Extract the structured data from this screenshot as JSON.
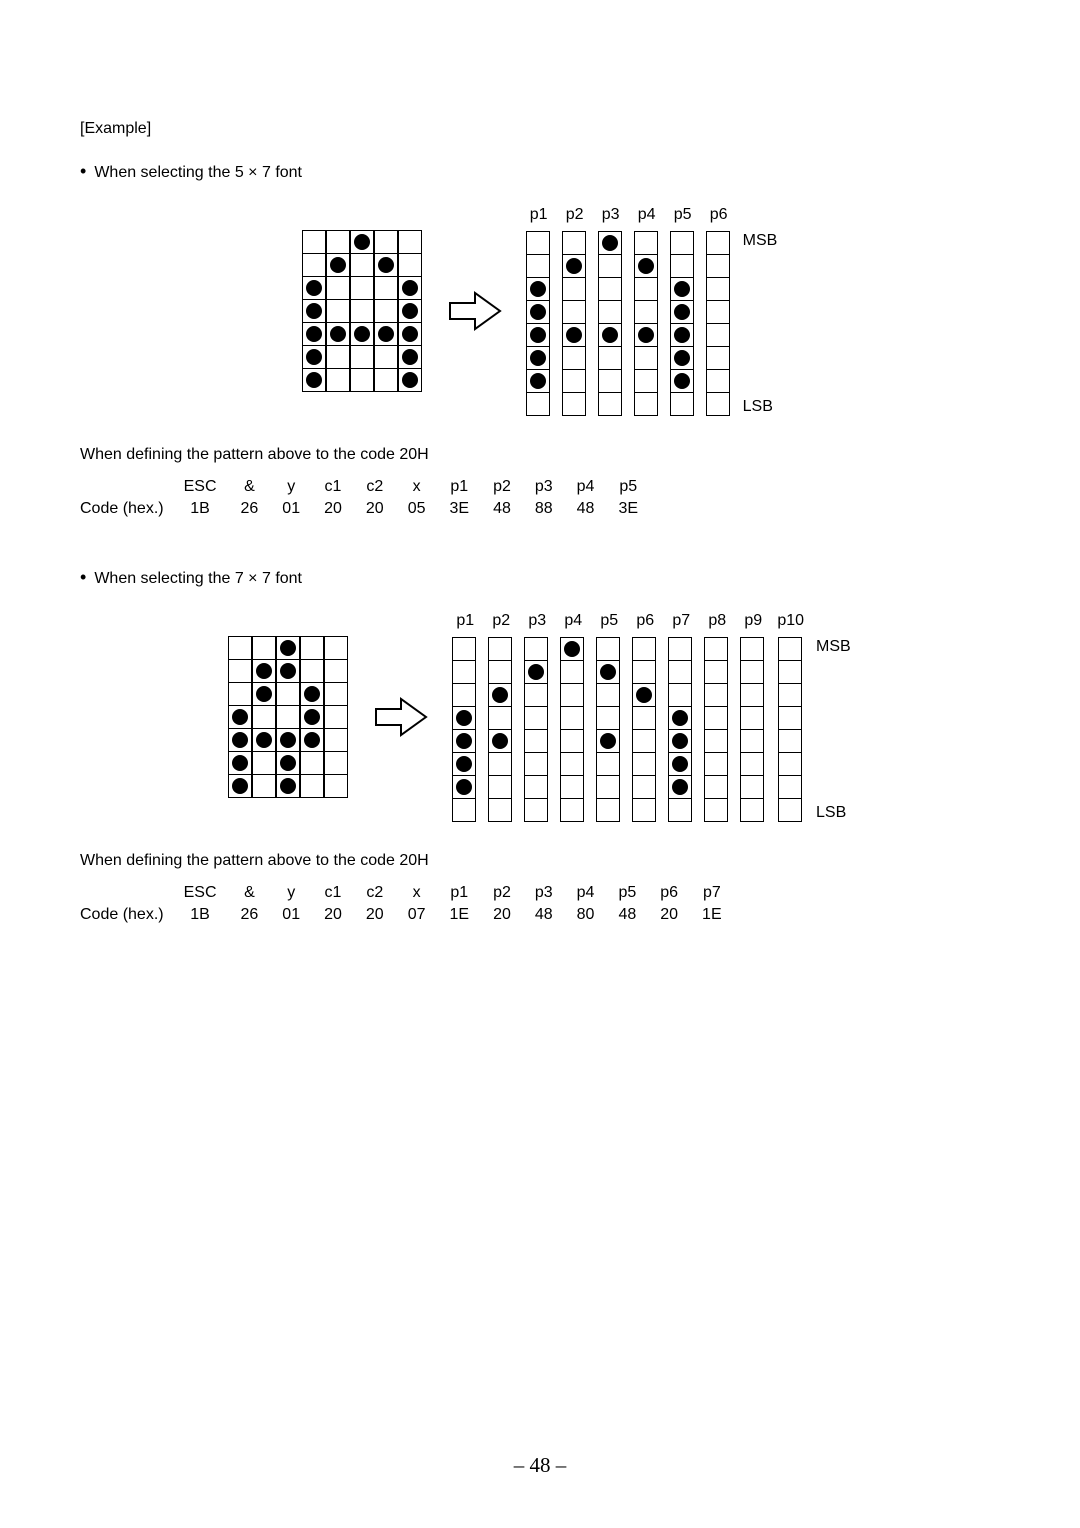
{
  "labels": {
    "example": "[Example]",
    "msb": "MSB",
    "lsb": "LSB",
    "code_hex": "Code (hex.)",
    "bullet": "•"
  },
  "page_number": "– 48 –",
  "example1": {
    "bullet_text": "When selecting the 5 × 7 font",
    "grid_cols": 5,
    "grid_rows": 7,
    "dots": [
      [
        0,
        2
      ],
      [
        1,
        1
      ],
      [
        1,
        3
      ],
      [
        2,
        0
      ],
      [
        2,
        4
      ],
      [
        3,
        0
      ],
      [
        3,
        4
      ],
      [
        4,
        0
      ],
      [
        4,
        1
      ],
      [
        4,
        2
      ],
      [
        4,
        3
      ],
      [
        4,
        4
      ],
      [
        5,
        0
      ],
      [
        5,
        4
      ],
      [
        6,
        0
      ],
      [
        6,
        4
      ]
    ],
    "col_count": 6,
    "col_labels": [
      "p1",
      "p2",
      "p3",
      "p4",
      "p5",
      "p6"
    ],
    "col_rows": 8,
    "col_dots": {
      "0": [
        2,
        3,
        4,
        5,
        6
      ],
      "1": [
        1,
        4
      ],
      "2": [
        0,
        4
      ],
      "3": [
        1,
        4
      ],
      "4": [
        2,
        3,
        4,
        5,
        6
      ],
      "5": []
    },
    "define_text": "When defining the pattern above to the code 20H",
    "table_header": [
      "ESC",
      "&",
      "y",
      "c1",
      "c2",
      "x",
      "p1",
      "p2",
      "p3",
      "p4",
      "p5"
    ],
    "table_values": [
      "1B",
      "26",
      "01",
      "20",
      "20",
      "05",
      "3E",
      "48",
      "88",
      "48",
      "3E"
    ]
  },
  "example2": {
    "bullet_text": "When selecting the 7 × 7 font",
    "grid_cols": 5,
    "grid_rows": 7,
    "dots": [
      [
        0,
        2
      ],
      [
        1,
        1
      ],
      [
        1,
        2
      ],
      [
        2,
        1
      ],
      [
        2,
        3
      ],
      [
        3,
        0
      ],
      [
        3,
        3
      ],
      [
        4,
        0
      ],
      [
        4,
        1
      ],
      [
        4,
        2
      ],
      [
        4,
        3
      ],
      [
        5,
        0
      ],
      [
        5,
        2
      ],
      [
        6,
        0
      ],
      [
        6,
        2
      ]
    ],
    "col_count": 10,
    "col_labels": [
      "p1",
      "p2",
      "p3",
      "p4",
      "p5",
      "p6",
      "p7",
      "p8",
      "p9",
      "p10"
    ],
    "col_rows": 8,
    "col_dots": {
      "0": [
        3,
        4,
        5,
        6
      ],
      "1": [
        2,
        4
      ],
      "2": [
        1
      ],
      "3": [
        0
      ],
      "4": [
        1,
        4
      ],
      "5": [
        2
      ],
      "6": [
        3,
        4,
        5,
        6
      ],
      "7": [],
      "8": [],
      "9": []
    },
    "define_text": "When defining the pattern above to the code 20H",
    "table_header": [
      "ESC",
      "&",
      "y",
      "c1",
      "c2",
      "x",
      "p1",
      "p2",
      "p3",
      "p4",
      "p5",
      "p6",
      "p7"
    ],
    "table_values": [
      "1B",
      "26",
      "01",
      "20",
      "20",
      "07",
      "1E",
      "20",
      "48",
      "80",
      "48",
      "20",
      "1E"
    ]
  }
}
